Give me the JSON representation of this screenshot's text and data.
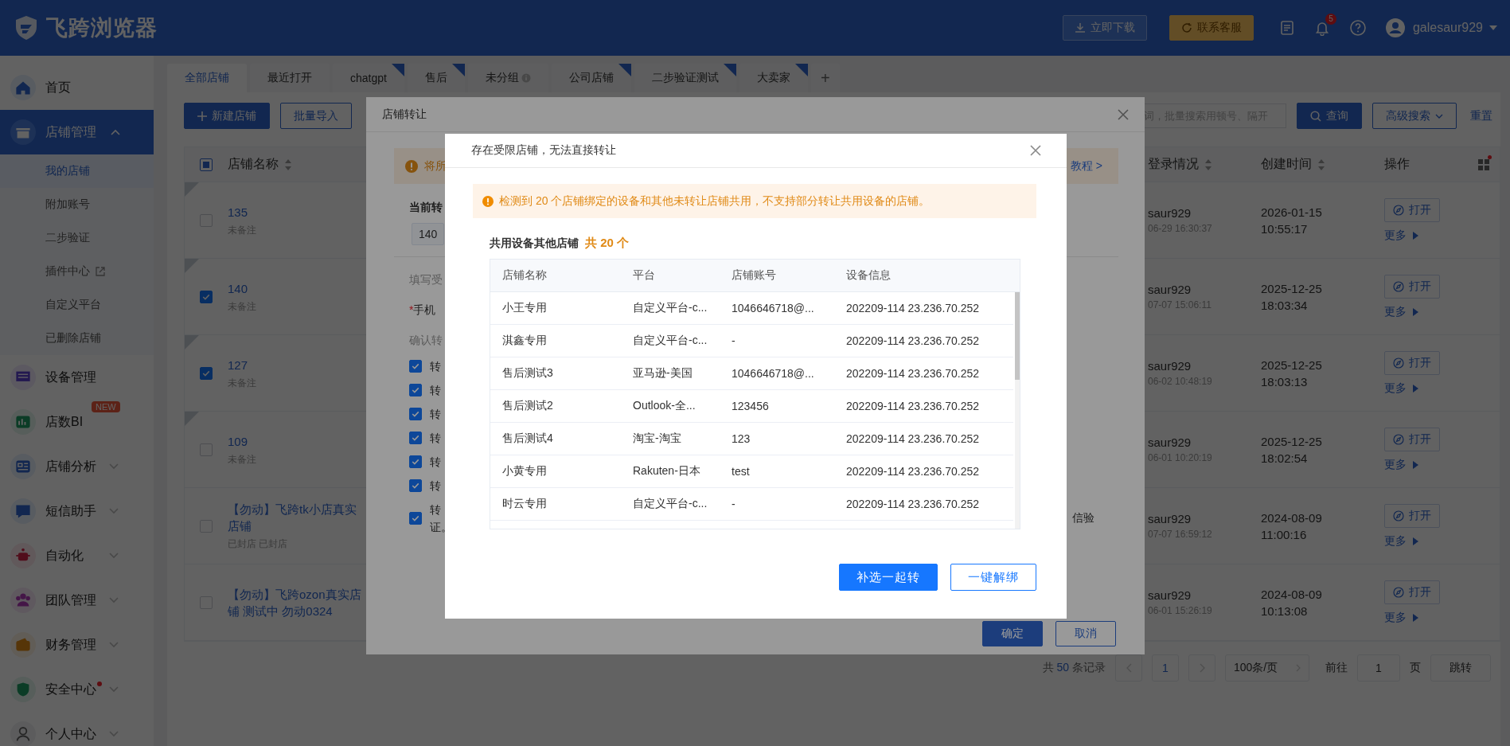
{
  "app": {
    "logo": "飞跨浏览器"
  },
  "header": {
    "download": "立即下载",
    "support": "联系客服",
    "notifications": "5",
    "user": "galesaur929"
  },
  "sidebar": {
    "items": [
      {
        "label": "首页",
        "selected": false,
        "alert": false
      },
      {
        "label": "店铺管理",
        "selected": true,
        "expanded": true,
        "alert": false,
        "children": [
          {
            "label": "我的店铺",
            "selected": true,
            "external": false
          },
          {
            "label": "附加账号",
            "selected": false,
            "external": false
          },
          {
            "label": "二步验证",
            "selected": false,
            "external": false
          },
          {
            "label": "插件中心",
            "selected": false,
            "external": true
          },
          {
            "label": "自定义平台",
            "selected": false,
            "external": false
          },
          {
            "label": "已删除店铺",
            "selected": false,
            "external": false
          }
        ]
      },
      {
        "label": "设备管理",
        "selected": false,
        "alert": false
      },
      {
        "label": "店数BI",
        "selected": false,
        "alert": false,
        "badge": "NEW"
      },
      {
        "label": "店铺分析",
        "selected": false,
        "expanded": false,
        "alert": false
      },
      {
        "label": "短信助手",
        "selected": false,
        "expanded": false,
        "alert": false
      },
      {
        "label": "自动化",
        "selected": false,
        "expanded": false,
        "alert": false
      },
      {
        "label": "团队管理",
        "selected": false,
        "expanded": false,
        "alert": false
      },
      {
        "label": "财务管理",
        "selected": false,
        "expanded": false,
        "alert": false
      },
      {
        "label": "安全中心",
        "selected": false,
        "expanded": false,
        "alert": true
      },
      {
        "label": "个人中心",
        "selected": false,
        "expanded": false,
        "alert": false
      }
    ]
  },
  "tabs": {
    "items": [
      {
        "label": "全部店铺",
        "selected": true,
        "shared": false,
        "info": false
      },
      {
        "label": "最近打开",
        "selected": false,
        "shared": false,
        "info": false
      },
      {
        "label": "chatgpt",
        "selected": false,
        "shared": true,
        "info": false
      },
      {
        "label": "售后",
        "selected": false,
        "shared": true,
        "info": false
      },
      {
        "label": "未分组",
        "selected": false,
        "shared": false,
        "info": true
      },
      {
        "label": "公司店铺",
        "selected": false,
        "shared": true,
        "info": false
      },
      {
        "label": "二步验证测试",
        "selected": false,
        "shared": true,
        "info": false
      },
      {
        "label": "大卖家",
        "selected": false,
        "shared": true,
        "info": false
      }
    ],
    "add": "+"
  },
  "toolbar": {
    "new_store": "新建店铺",
    "import": "批量导入",
    "search_placeholder": "词，批量搜索用顿号、隔开",
    "query": "查询",
    "advanced": "高级搜索",
    "reset": "重置"
  },
  "table": {
    "select_all_partial": true,
    "columns": [
      {
        "label": "店铺名称",
        "sortable": true
      },
      {
        "label": "登录情况",
        "sortable": true
      },
      {
        "label": "创建时间",
        "sortable": true
      },
      {
        "label": "操作",
        "sortable": false
      }
    ],
    "rows": [
      {
        "name": "135",
        "remark": "未备注",
        "checked": false,
        "pinned": true,
        "login_user": "saur929",
        "login_time": "06-29 16:30:37",
        "created_date": "2026-01-15",
        "created_time": "10:55:17",
        "open": "打开",
        "more": "更多"
      },
      {
        "name": "140",
        "remark": "未备注",
        "checked": true,
        "pinned": true,
        "login_user": "saur929",
        "login_time": "07-07 15:06:11",
        "created_date": "2025-12-25",
        "created_time": "18:03:34",
        "open": "打开",
        "more": "更多"
      },
      {
        "name": "127",
        "remark": "未备注",
        "checked": true,
        "pinned": true,
        "login_user": "saur929",
        "login_time": "06-02 10:48:19",
        "created_date": "2025-12-25",
        "created_time": "18:03:13",
        "open": "打开",
        "more": "更多"
      },
      {
        "name": "109",
        "remark": "未备注",
        "checked": false,
        "pinned": true,
        "login_user": "saur929",
        "login_time": "06-01 10:20:19",
        "created_date": "2025-12-25",
        "created_time": "18:02:54",
        "open": "打开",
        "more": "更多"
      },
      {
        "name": "【勿动】飞跨tk小店真实店铺",
        "remark": "已封店 已封店",
        "checked": false,
        "pinned": false,
        "login_user": "saur929",
        "login_time": "07-07 16:59:12",
        "created_date": "2024-08-09",
        "created_time": "11:00:16",
        "open": "打开",
        "more": "更多"
      },
      {
        "name": "【勿动】飞跨ozon真实店铺 测试中 勿动0324",
        "checked": false,
        "pinned": false,
        "login_user": "saur929",
        "login_time": "06-01 15:26:19",
        "created_date": "2024-08-09",
        "created_time": "10:13:08",
        "open": "打开",
        "more": "更多"
      }
    ]
  },
  "pagination": {
    "total_prefix": "共",
    "total": "50",
    "total_suffix": "条记录",
    "page": "1",
    "page_size": "100条/页",
    "goto": "前往",
    "goto_value": "1",
    "page_unit": "页",
    "jump": "跳转"
  },
  "transfer_dialog": {
    "title": "店铺转让",
    "notice": "将所",
    "tutorial": "教程 >",
    "current_label": "当前转",
    "current_store": "140",
    "fill_label": "填写受",
    "phone_required": "*",
    "phone_label": "手机",
    "confirm_label": "确认转",
    "options": [
      {
        "label": "转",
        "checked": true
      },
      {
        "label": "转",
        "checked": true
      },
      {
        "label": "转",
        "checked": true
      },
      {
        "label": "转",
        "checked": true
      },
      {
        "label": "转",
        "checked": true
      },
      {
        "label": "转",
        "checked": true
      },
      {
        "label": "转",
        "continuation": "证。",
        "checked": true
      }
    ],
    "side_text": "信验",
    "ok": "确定",
    "cancel": "取消"
  },
  "restricted_dialog": {
    "title": "存在受限店铺，无法直接转让",
    "warning": "检测到 20 个店铺绑定的设备和其他未转让店铺共用，不支持部分转让共用设备的店铺。",
    "list_title": "共用设备其他店铺",
    "list_count": "共 20 个",
    "columns": [
      "店铺名称",
      "平台",
      "店铺账号",
      "设备信息"
    ],
    "rows": [
      [
        "小王专用",
        "自定义平台-c...",
        "1046646718@...",
        "202209-114 23.236.70.252"
      ],
      [
        "淇鑫专用",
        "自定义平台-c...",
        "-",
        "202209-114 23.236.70.252"
      ],
      [
        "售后测试3",
        "亚马逊-美国",
        "1046646718@...",
        "202209-114 23.236.70.252"
      ],
      [
        "售后测试2",
        "Outlook-全...",
        "123456",
        "202209-114 23.236.70.252"
      ],
      [
        "售后测试4",
        "淘宝-淘宝",
        "123",
        "202209-114 23.236.70.252"
      ],
      [
        "小黄专用",
        "Rakuten-日本",
        "test",
        "202209-114 23.236.70.252"
      ],
      [
        "时云专用",
        "自定义平台-c...",
        "-",
        "202209-114 23.236.70.252"
      ]
    ],
    "primary": "补选一起转",
    "secondary": "一键解绑"
  }
}
